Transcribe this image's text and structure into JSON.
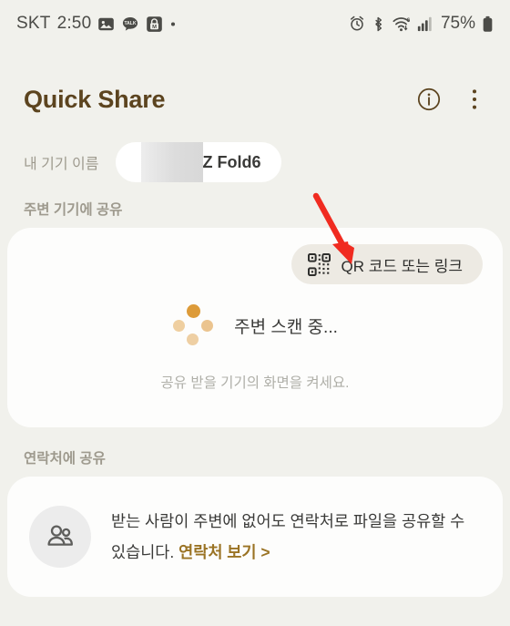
{
  "status_bar": {
    "carrier": "SKT",
    "time": "2:50",
    "left_icons": [
      "image-icon",
      "kakaotalk-icon",
      "lock-m-icon",
      "dot-icon"
    ],
    "right_icons": [
      "alarm-icon",
      "bluetooth-icon",
      "wifi-6-icon",
      "cellular-signal-icon"
    ],
    "battery_percent": "75%",
    "battery_icon": "battery-icon",
    "text_color": "#4B4B47"
  },
  "header": {
    "title": "Quick Share",
    "title_color": "#5C441F",
    "info_icon": "info-circle-icon",
    "overflow_icon": "more-vertical-icon"
  },
  "device": {
    "label": "내 기기 이름",
    "name": "Z Fold6",
    "redacted": true
  },
  "nearby": {
    "section_label": "주변 기기에 공유",
    "qr_button_label": "QR 코드 또는 링크",
    "qr_icon": "qr-code-icon",
    "scanning_text": "주변 스캔 중...",
    "hint_text": "공유 받을 기기의 화면을 켜세요.",
    "spinner_colors": [
      "#DD9B39",
      "#EBC48F",
      "#EECFA3",
      "#EFCFA0"
    ]
  },
  "contacts": {
    "section_label": "연락처에 공유",
    "avatar_icon": "people-icon",
    "description": "받는 사람이 주변에 없어도 연락처로 파일을 공유할 수 있습니다.",
    "link_label": "연락처 보기 >",
    "link_color": "#9A7324"
  },
  "annotation": {
    "arrow_color": "#F02B20",
    "points_to": "qr-code-button"
  },
  "theme": {
    "background": "#F1F1EC",
    "card_background": "#FDFDFC",
    "accent": "#5C441F"
  }
}
